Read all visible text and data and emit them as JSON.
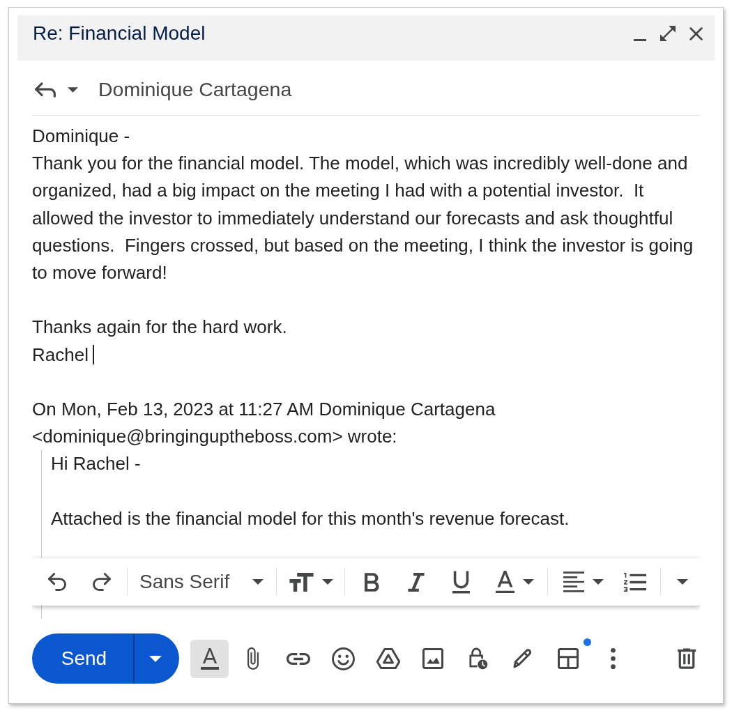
{
  "window": {
    "title": "Re: Financial Model"
  },
  "recipient": {
    "name": "Dominique Cartagena"
  },
  "message": {
    "paragraphs": [
      [
        "Dominique -",
        "Thank you for the financial model. The model, which was incredibly well-done and organized, had a big impact on the meeting I had with a potential investor.  It allowed the investor to immediately understand our forecasts and ask thoughtful questions.  Fingers crossed, but based on the meeting, I think the investor is going to move forward!"
      ],
      [
        "Thanks again for the hard work.",
        "Rachel"
      ]
    ],
    "cursor_at_end": true
  },
  "quoted": {
    "attribution": "On Mon, Feb 13, 2023 at 11:27 AM Dominique Cartagena <dominique@bringinguptheboss.com> wrote:",
    "paragraphs": [
      [
        "Hi Rachel -"
      ],
      [
        "Attached is the financial model for this month's revenue forecast."
      ]
    ]
  },
  "format_toolbar": {
    "font": "Sans Serif"
  },
  "bottom_bar": {
    "send_label": "Send",
    "formatting_on": true,
    "layout_badge": true
  }
}
